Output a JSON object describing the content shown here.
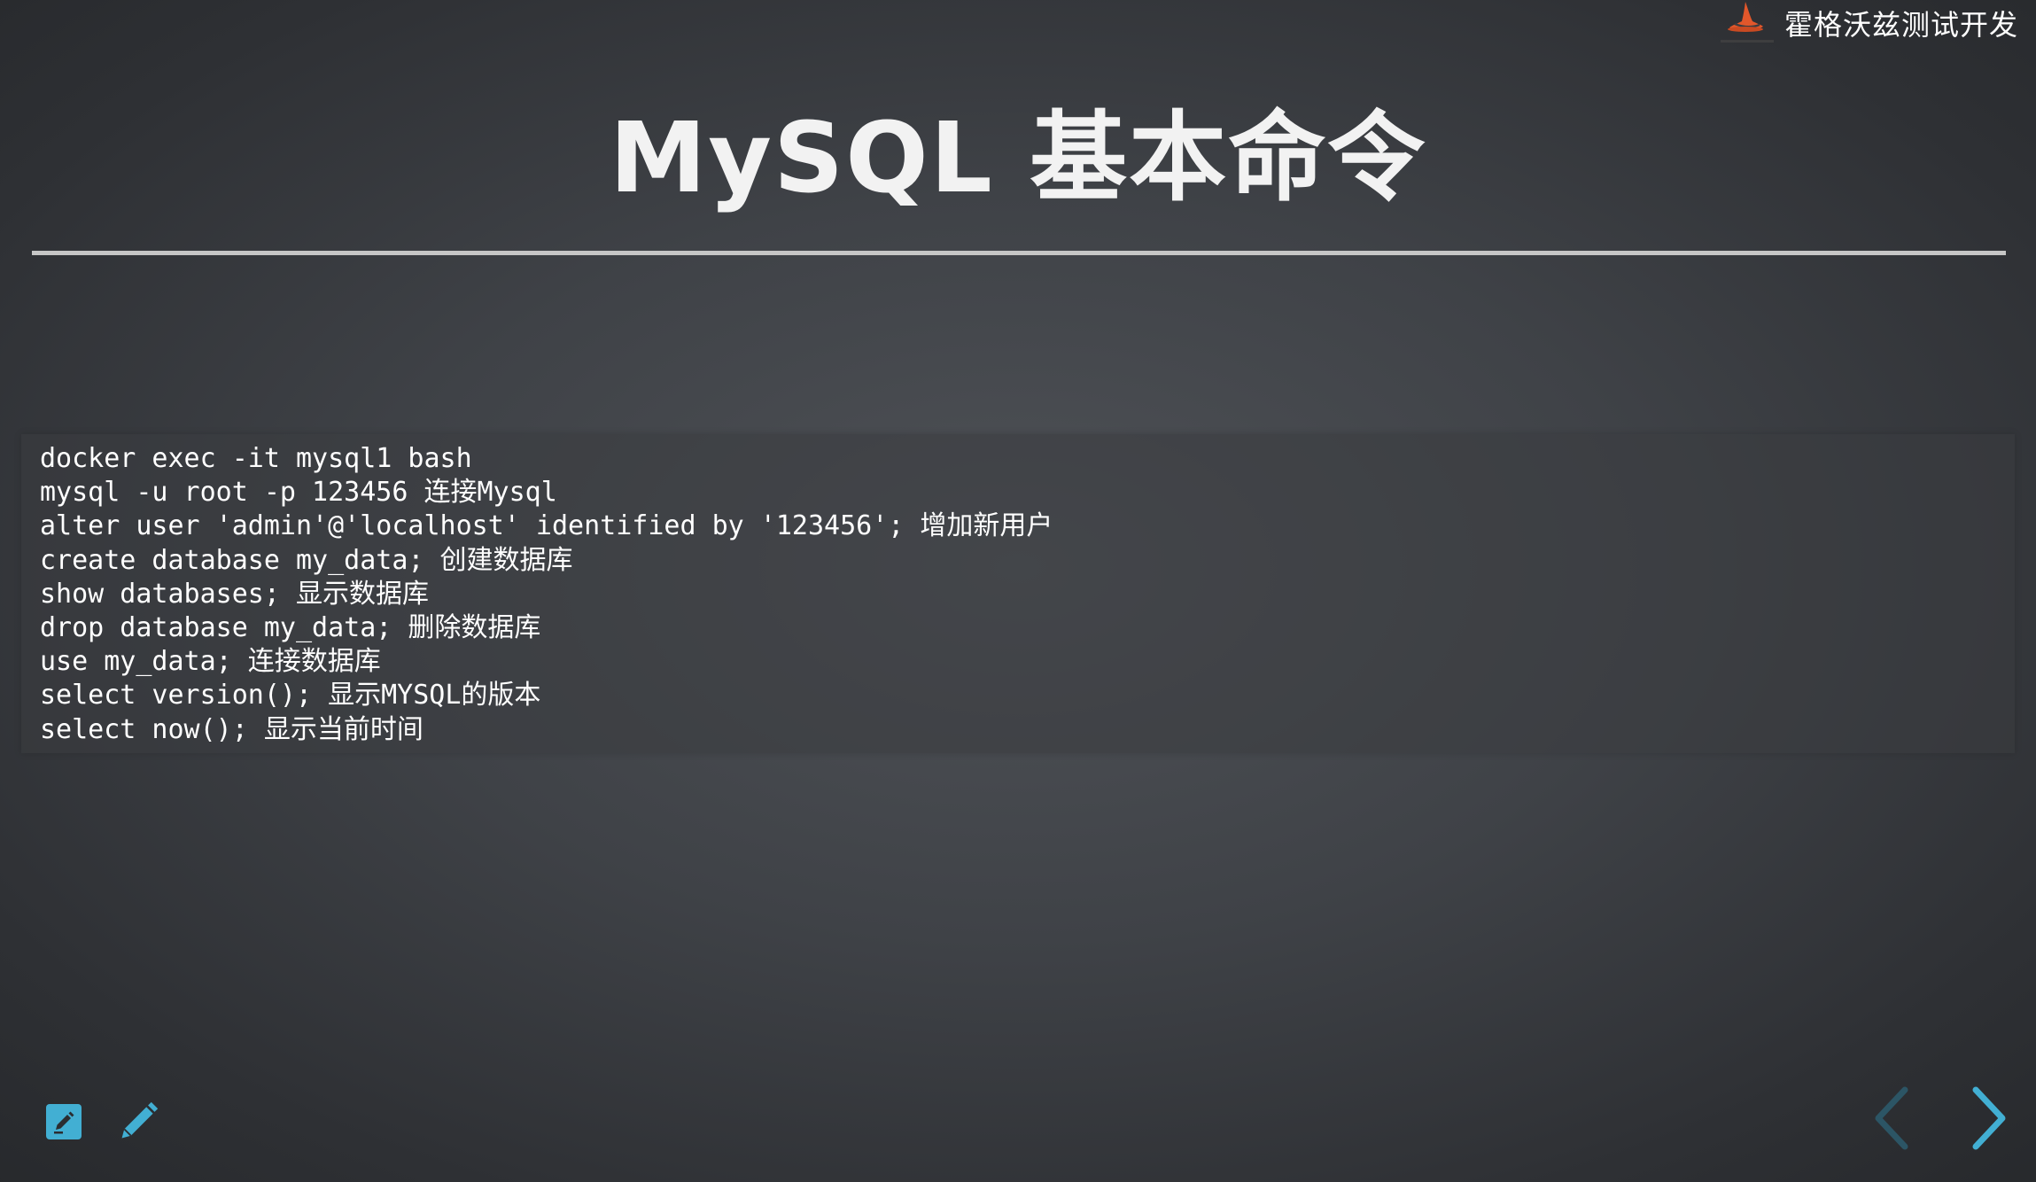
{
  "brand": {
    "name": "霍格沃兹测试开发",
    "logo_icon": "wizard-hat-logo-icon"
  },
  "slide": {
    "title": "MySQL 基本命令",
    "code_lines": [
      "docker exec -it mysql1 bash",
      "mysql -u root -p 123456 连接Mysql",
      "alter user 'admin'@'localhost' identified by '123456'; 增加新用户",
      "create database my_data; 创建数据库",
      "show databases; 显示数据库",
      "drop database my_data; 删除数据库",
      "use my_data; 连接数据库",
      "select version(); 显示MYSQL的版本",
      "select now(); 显示当前时间"
    ]
  },
  "toolbar": {
    "edit_icon": "edit-note-icon",
    "pen_icon": "pencil-icon"
  },
  "navigation": {
    "prev_icon": "chevron-left-icon",
    "next_icon": "chevron-right-icon"
  },
  "colors": {
    "accent": "#42afd3",
    "title_rule": "#c6c6c6",
    "logo_orange": "#e2572b",
    "nav_prev_disabled": "#2c5565"
  }
}
